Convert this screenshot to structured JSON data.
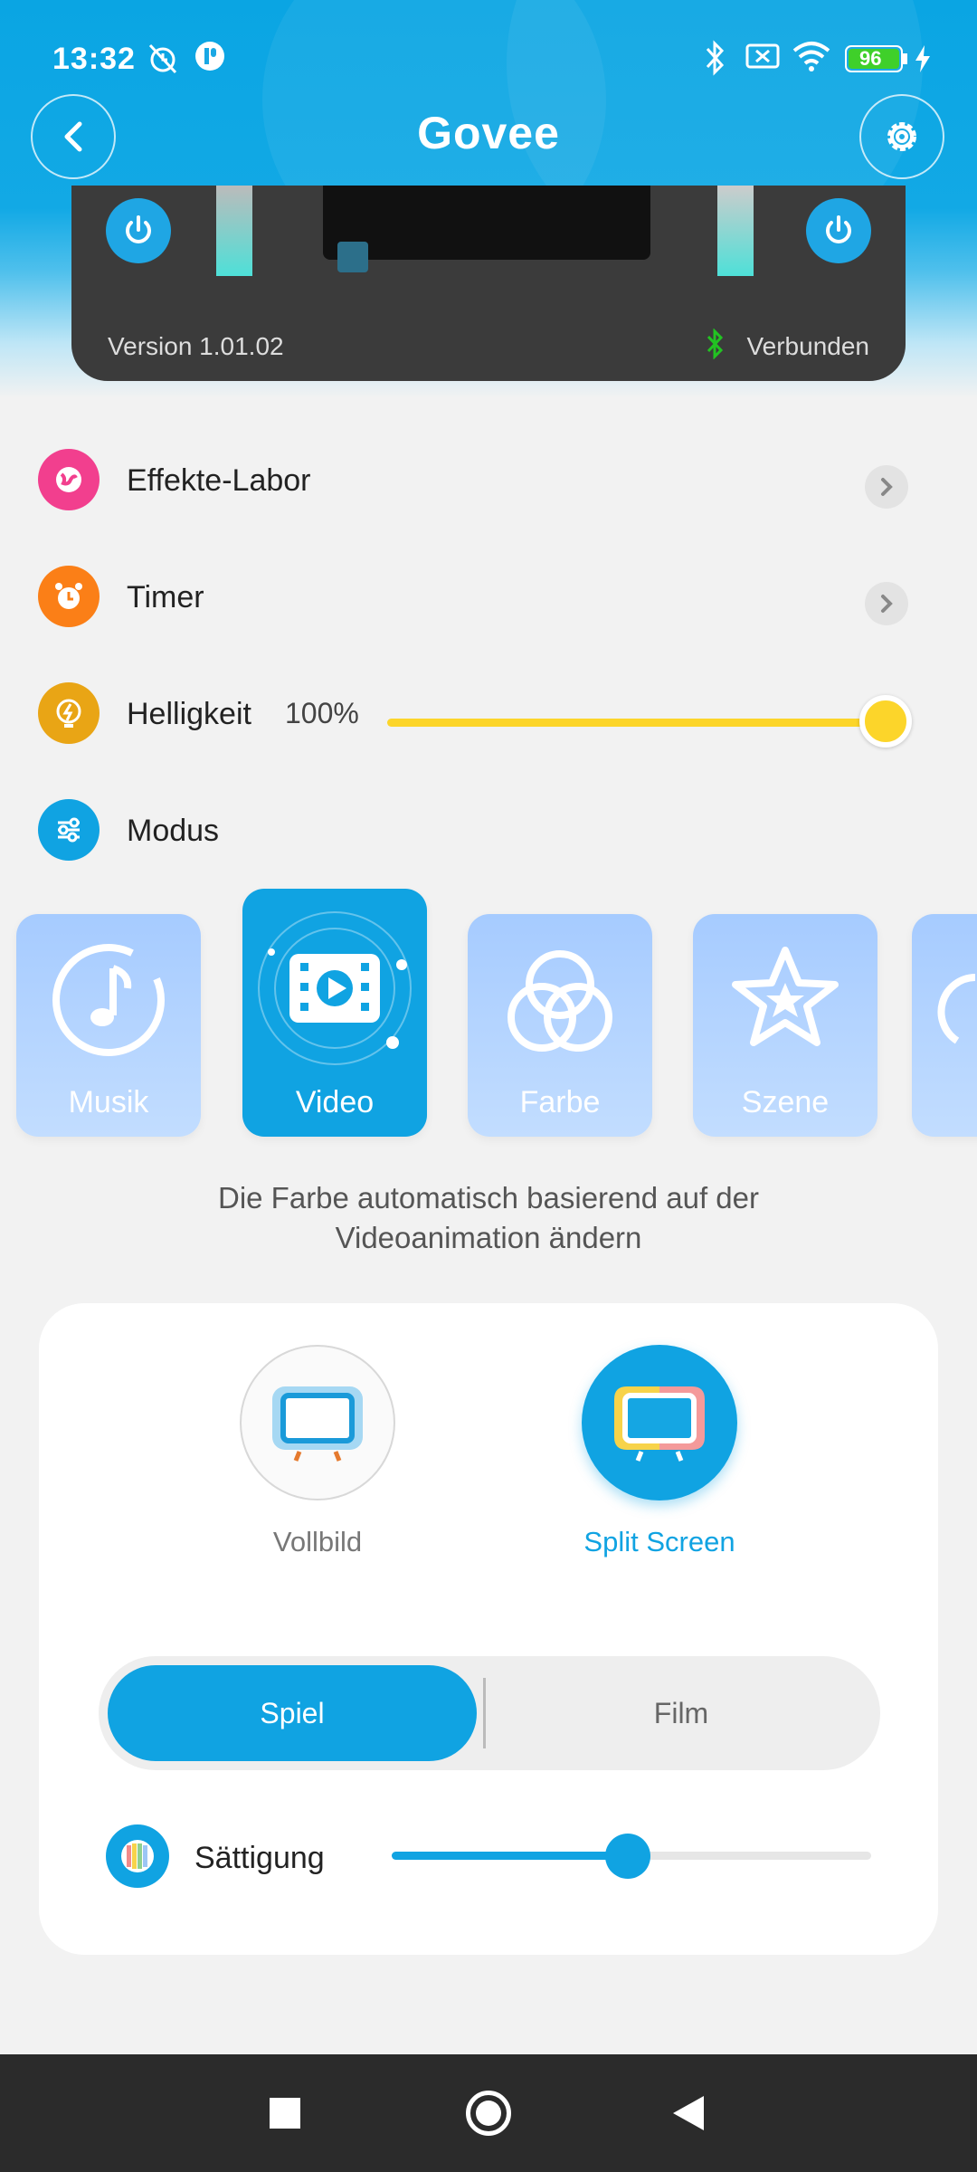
{
  "status_bar": {
    "time": "13:32",
    "battery": "96"
  },
  "header": {
    "brand": "Govee",
    "back_icon": "back-arrow-icon",
    "settings_icon": "gear-icon"
  },
  "device": {
    "version": "Version 1.01.02",
    "status": "Verbunden"
  },
  "menu": {
    "effects_lab": "Effekte-Labor",
    "timer": "Timer",
    "brightness_label": "Helligkeit",
    "brightness_value": "100%",
    "brightness_level": 1.0,
    "mode_label": "Modus"
  },
  "modes": [
    {
      "label": "Musik",
      "icon": "music-icon",
      "active": false
    },
    {
      "label": "Video",
      "icon": "video-icon",
      "active": true
    },
    {
      "label": "Farbe",
      "icon": "color-circles-icon",
      "active": false
    },
    {
      "label": "Szene",
      "icon": "star-icon",
      "active": false
    }
  ],
  "mode_description": "Die Farbe automatisch basierend auf der Videoanimation ändern",
  "video_settings": {
    "fullscreen_label": "Vollbild",
    "splitscreen_label": "Split Screen",
    "selected": "Split Screen",
    "segment_game": "Spiel",
    "segment_film": "Film",
    "segment_selected": "Spiel",
    "saturation_label": "Sättigung",
    "saturation_level": 0.5
  },
  "colors": {
    "accent": "#10a3e2",
    "brightness": "#fcd52a",
    "connected": "#22c322"
  }
}
